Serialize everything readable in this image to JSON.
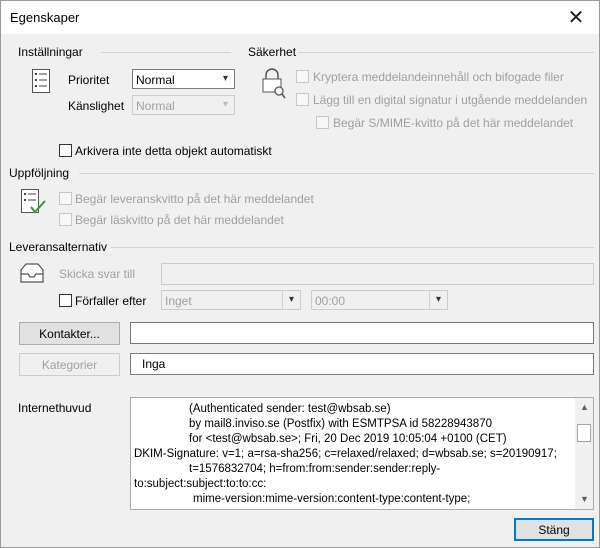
{
  "window": {
    "title": "Egenskaper"
  },
  "settings": {
    "heading": "Inställningar",
    "priority_label": "Prioritet",
    "priority_value": "Normal",
    "sensitivity_label": "Känslighet",
    "sensitivity_value": "Normal",
    "archive_label": "Arkivera inte detta objekt automatiskt"
  },
  "security": {
    "heading": "Säkerhet",
    "encrypt_label": "Kryptera meddelandeinnehåll och bifogade filer",
    "signature_label": "Lägg till en digital signatur i utgående meddelanden",
    "smime_label": "Begär S/MIME-kvitto på det här meddelandet"
  },
  "tracking": {
    "heading": "Uppföljning",
    "delivery_receipt_label": "Begär leveranskvitto på det här meddelandet",
    "read_receipt_label": "Begär läskvitto på det här meddelandet"
  },
  "delivery": {
    "heading": "Leveransalternativ",
    "reply_to_label": "Skicka svar till",
    "reply_to_value": "",
    "expires_label": "Förfaller efter",
    "expires_date": "Inget",
    "expires_time": "00:00"
  },
  "contacts": {
    "button_label": "Kontakter...",
    "value": ""
  },
  "categories": {
    "button_label": "Kategorier",
    "value": "Inga"
  },
  "internet_headers": {
    "label": "Internethuvud",
    "lines": [
      "(Authenticated sender: test@wbsab.se)",
      "by mail8.inviso.se (Postfix) with ESMTPSA id 58228943870",
      "for <test@wbsab.se>; Fri, 20 Dec 2019 10:05:04 +0100 (CET)",
      "DKIM-Signature: v=1; a=rsa-sha256; c=relaxed/relaxed; d=wbsab.se; s=20190917;",
      "t=1576832704; h=from:from:sender:sender:reply-",
      "to:subject:subject:to:to:cc:",
      "mime-version:mime-version:content-type:content-type;"
    ]
  },
  "footer": {
    "close_label": "Stäng"
  }
}
